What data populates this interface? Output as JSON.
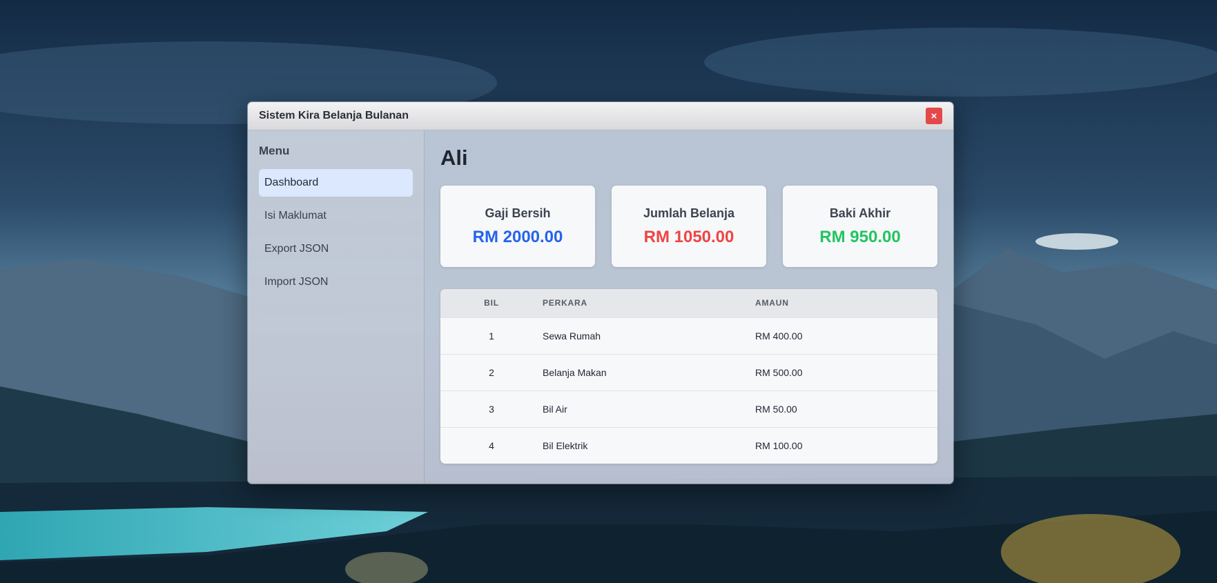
{
  "window": {
    "title": "Sistem Kira Belanja Bulanan",
    "close_label": "×"
  },
  "sidebar": {
    "title": "Menu",
    "items": [
      {
        "label": "Dashboard",
        "active": true
      },
      {
        "label": "Isi Maklumat",
        "active": false
      },
      {
        "label": "Export JSON",
        "active": false
      },
      {
        "label": "Import JSON",
        "active": false
      }
    ]
  },
  "main": {
    "user_name": "Ali",
    "cards": [
      {
        "label": "Gaji Bersih",
        "value": "RM 2000.00",
        "color": "#2563eb"
      },
      {
        "label": "Jumlah Belanja",
        "value": "RM 1050.00",
        "color": "#ef4444"
      },
      {
        "label": "Baki Akhir",
        "value": "RM 950.00",
        "color": "#22c55e"
      }
    ],
    "table": {
      "headers": [
        "BIL",
        "PERKARA",
        "AMAUN"
      ],
      "rows": [
        [
          "1",
          "Sewa Rumah",
          "RM 400.00"
        ],
        [
          "2",
          "Belanja Makan",
          "RM 500.00"
        ],
        [
          "3",
          "Bil Air",
          "RM 50.00"
        ],
        [
          "4",
          "Bil Elektrik",
          "RM 100.00"
        ]
      ]
    }
  }
}
